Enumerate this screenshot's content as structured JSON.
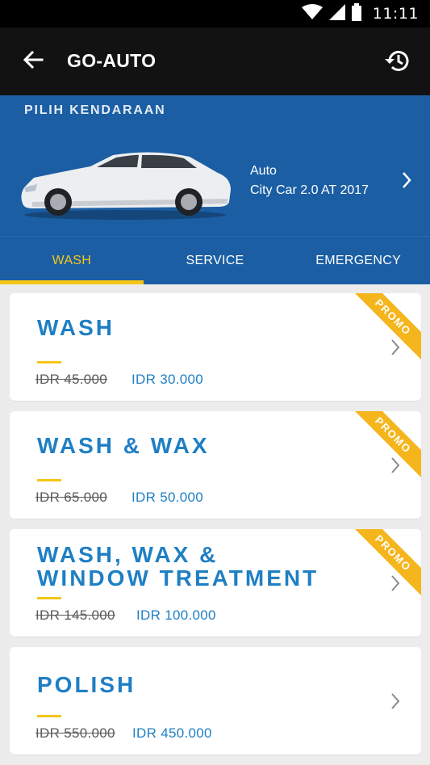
{
  "status_bar": {
    "time": "11:11"
  },
  "app_bar": {
    "title": "GO-AUTO"
  },
  "vehicle": {
    "heading": "PILIH KENDARAAN",
    "type": "Auto",
    "model": "City Car 2.0 AT 2017"
  },
  "tabs": [
    {
      "label": "WASH",
      "active": true
    },
    {
      "label": "SERVICE",
      "active": false
    },
    {
      "label": "EMERGENCY",
      "active": false
    }
  ],
  "services": [
    {
      "title": "WASH",
      "old_price": "IDR 45.000",
      "new_price": "IDR 30.000",
      "promo": "PROMO"
    },
    {
      "title": "WASH & WAX",
      "old_price": "IDR 65.000",
      "new_price": "IDR 50.000",
      "promo": "PROMO"
    },
    {
      "title_line1": "WASH, WAX &",
      "title_line2": "WINDOW TREATMENT",
      "old_price": "IDR 145.000",
      "new_price": "IDR 100.000",
      "promo": "PROMO"
    },
    {
      "title": "POLISH",
      "old_price": "IDR 550.000",
      "new_price": "IDR 450.000"
    }
  ],
  "colors": {
    "primary_blue": "#1b5ea3",
    "text_blue": "#1f7fc4",
    "accent_yellow": "#f5c518",
    "app_bar": "#121212"
  },
  "icons": {
    "back": "arrow-left-icon",
    "history": "history-icon",
    "chevron": "chevron-right-icon",
    "wifi": "wifi-icon",
    "signal": "signal-icon",
    "battery": "battery-icon"
  }
}
